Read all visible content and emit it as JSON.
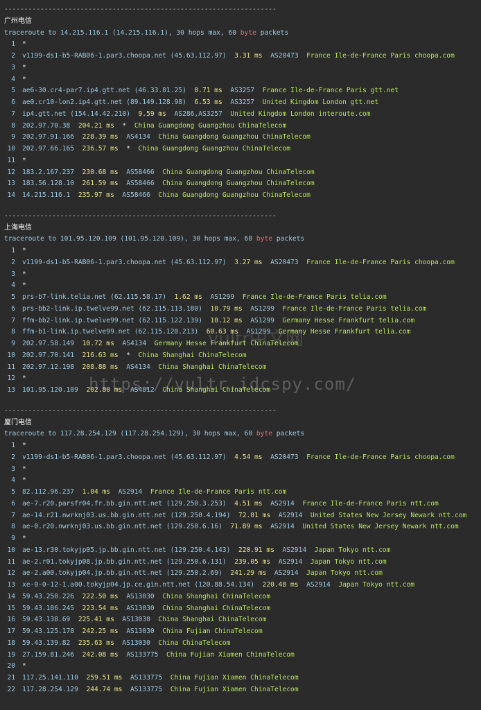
{
  "separator": "--------------------------------------------------------------------",
  "watermark": "https://vultr.idcspy.com/",
  "watermark_cn": "vultr中文网",
  "colors": {
    "background": "#2b2b2b",
    "host": "#9ccde8",
    "latency": "#ede489",
    "geo": "#b5e853",
    "byte": "#e06c75"
  },
  "traces": [
    {
      "title": "广州电信",
      "cmd_pre": "traceroute to 14.215.116.1 (14.215.116.1), 30 hops max, 60 ",
      "cmd_byte": "byte",
      "cmd_post": " packets",
      "hops": [
        {
          "n": "1",
          "star": "*"
        },
        {
          "n": "2",
          "host": "v1199-ds1-b5-RAB06-1.par3.choopa.net (45.63.112.97)",
          "lat": "3.31 ms",
          "asn": "AS20473",
          "geo": "France Ile-de-France Paris choopa.com"
        },
        {
          "n": "3",
          "star": "*"
        },
        {
          "n": "4",
          "star": "*"
        },
        {
          "n": "5",
          "host": "ae6-30.cr4-par7.ip4.gtt.net (46.33.81.25)",
          "lat": "0.71 ms",
          "asn": "AS3257",
          "geo": "France Ile-de-France Paris gtt.net"
        },
        {
          "n": "6",
          "host": "ae0.cr10-lon2.ip4.gtt.net (89.149.128.98)",
          "lat": "6.53 ms",
          "asn": "AS3257",
          "geo": "United Kingdom London gtt.net"
        },
        {
          "n": "7",
          "host": "ip4.gtt.net (154.14.42.210)",
          "lat": "9.59 ms",
          "asn": "AS286,AS3257",
          "geo": "United Kingdom London interoute.com"
        },
        {
          "n": "8",
          "host": "202.97.70.38",
          "lat": "204.21 ms",
          "asn": "*",
          "geo": "China Guangdong Guangzhou ChinaTelecom"
        },
        {
          "n": "9",
          "host": "202.97.91.166",
          "lat": "228.39 ms",
          "asn": "AS4134",
          "geo": "China Guangdong Guangzhou ChinaTelecom"
        },
        {
          "n": "10",
          "host": "202.97.66.165",
          "lat": "236.57 ms",
          "asn": "*",
          "geo": "China Guangdong Guangzhou ChinaTelecom"
        },
        {
          "n": "11",
          "star": "*"
        },
        {
          "n": "12",
          "host": "183.2.167.237",
          "lat": "230.68 ms",
          "asn": "AS58466",
          "geo": "China Guangdong Guangzhou ChinaTelecom"
        },
        {
          "n": "13",
          "host": "183.56.128.10",
          "lat": "261.59 ms",
          "asn": "AS58466",
          "geo": "China Guangdong Guangzhou ChinaTelecom"
        },
        {
          "n": "14",
          "host": "14.215.116.1",
          "lat": "235.97 ms",
          "asn": "AS58466",
          "geo": "China Guangdong Guangzhou ChinaTelecom"
        }
      ]
    },
    {
      "title": "上海电信",
      "cmd_pre": "traceroute to 101.95.120.109 (101.95.120.109), 30 hops max, 60 ",
      "cmd_byte": "byte",
      "cmd_post": " packets",
      "hops": [
        {
          "n": "1",
          "star": "*"
        },
        {
          "n": "2",
          "host": "v1199-ds1-b5-RAB06-1.par3.choopa.net (45.63.112.97)",
          "lat": "3.27 ms",
          "asn": "AS20473",
          "geo": "France Ile-de-France Paris choopa.com"
        },
        {
          "n": "3",
          "star": "*"
        },
        {
          "n": "4",
          "star": "*"
        },
        {
          "n": "5",
          "host": "prs-b7-link.telia.net (62.115.58.17)",
          "lat": "1.62 ms",
          "asn": "AS1299",
          "geo": "France Ile-de-France Paris telia.com"
        },
        {
          "n": "6",
          "host": "prs-bb2-link.ip.twelve99.net (62.115.113.180)",
          "lat": "10.79 ms",
          "asn": "AS1299",
          "geo": "France Ile-de-France Paris telia.com"
        },
        {
          "n": "7",
          "host": "ffm-bb2-link.ip.twelve99.net (62.115.122.139)",
          "lat": "10.12 ms",
          "asn": "AS1299",
          "geo": "Germany Hesse Frankfurt telia.com"
        },
        {
          "n": "8",
          "host": "ffm-b1-link.ip.twelve99.net (62.115.120.213)",
          "lat": "60.63 ms",
          "asn": "AS1299",
          "geo": "Germany Hesse Frankfurt telia.com"
        },
        {
          "n": "9",
          "host": "202.97.58.149",
          "lat": "10.72 ms",
          "asn": "AS4134",
          "geo": "Germany Hesse Frankfurt ChinaTelecom"
        },
        {
          "n": "10",
          "host": "202.97.70.141",
          "lat": "216.63 ms",
          "asn": "*",
          "geo": "China Shanghai ChinaTelecom"
        },
        {
          "n": "11",
          "host": "202.97.12.198",
          "lat": "208.88 ms",
          "asn": "AS4134",
          "geo": "China Shanghai ChinaTelecom"
        },
        {
          "n": "12",
          "star": "*"
        },
        {
          "n": "13",
          "host": "101.95.120.109",
          "lat": "202.80 ms",
          "asn": "AS4812",
          "geo": "China Shanghai ChinaTelecom"
        }
      ]
    },
    {
      "title": "厦门电信",
      "cmd_pre": "traceroute to 117.28.254.129 (117.28.254.129), 30 hops max, 60 ",
      "cmd_byte": "byte",
      "cmd_post": " packets",
      "hops": [
        {
          "n": "1",
          "star": "*"
        },
        {
          "n": "2",
          "host": "v1199-ds1-b5-RAB06-1.par3.choopa.net (45.63.112.97)",
          "lat": "4.54 ms",
          "asn": "AS20473",
          "geo": "France Ile-de-France Paris choopa.com"
        },
        {
          "n": "3",
          "star": "*"
        },
        {
          "n": "4",
          "star": "*"
        },
        {
          "n": "5",
          "host": "82.112.96.237",
          "lat": "1.04 ms",
          "asn": "AS2914",
          "geo": "France Ile-de-France Paris ntt.com"
        },
        {
          "n": "6",
          "host": "ae-7.r20.parsfr04.fr.bb.gin.ntt.net (129.250.3.253)",
          "lat": "4.51 ms",
          "asn": "AS2914",
          "geo": "France Ile-de-France Paris ntt.com"
        },
        {
          "n": "7",
          "host": "ae-14.r21.nwrknj03.us.bb.gin.ntt.net (129.250.4.194)",
          "lat": "72.01 ms",
          "asn": "AS2914",
          "geo": "United States New Jersey Newark ntt.com"
        },
        {
          "n": "8",
          "host": "ae-0.r20.nwrknj03.us.bb.gin.ntt.net (129.250.6.16)",
          "lat": "71.89 ms",
          "asn": "AS2914",
          "geo": "United States New Jersey Newark ntt.com"
        },
        {
          "n": "9",
          "star": "*"
        },
        {
          "n": "10",
          "host": "ae-13.r30.tokyjp05.jp.bb.gin.ntt.net (129.250.4.143)",
          "lat": "220.91 ms",
          "asn": "AS2914",
          "geo": "Japan Tokyo ntt.com"
        },
        {
          "n": "11",
          "host": "ae-2.r01.tokyjp08.jp.bb.gin.ntt.net (129.250.6.131)",
          "lat": "239.05 ms",
          "asn": "AS2914",
          "geo": "Japan Tokyo ntt.com"
        },
        {
          "n": "12",
          "host": "ae-2.a00.tokyjp04.jp.bb.gin.ntt.net (129.250.2.69)",
          "lat": "241.29 ms",
          "asn": "AS2914",
          "geo": "Japan Tokyo ntt.com"
        },
        {
          "n": "13",
          "host": "xe-0-0-12-1.a00.tokyjp04.jp.ce.gin.ntt.net (120.88.54.134)",
          "lat": "220.48 ms",
          "asn": "AS2914",
          "geo": "Japan Tokyo ntt.com"
        },
        {
          "n": "14",
          "host": "59.43.250.226",
          "lat": "222.50 ms",
          "asn": "AS13030",
          "geo": "China Shanghai ChinaTelecom"
        },
        {
          "n": "15",
          "host": "59.43.186.245",
          "lat": "223.54 ms",
          "asn": "AS13030",
          "geo": "China Shanghai ChinaTelecom"
        },
        {
          "n": "16",
          "host": "59.43.138.69",
          "lat": "225.41 ms",
          "asn": "AS13030",
          "geo": "China Shanghai ChinaTelecom"
        },
        {
          "n": "17",
          "host": "59.43.125.178",
          "lat": "242.25 ms",
          "asn": "AS13030",
          "geo": "China Fujian ChinaTelecom"
        },
        {
          "n": "18",
          "host": "59.43.139.82",
          "lat": "235.63 ms",
          "asn": "AS13030",
          "geo": "China ChinaTelecom"
        },
        {
          "n": "19",
          "host": "27.159.81.246",
          "lat": "242.08 ms",
          "asn": "AS133775",
          "geo": "China Fujian Xiamen ChinaTelecom"
        },
        {
          "n": "20",
          "star": "*"
        },
        {
          "n": "21",
          "host": "117.25.141.110",
          "lat": "259.51 ms",
          "asn": "AS133775",
          "geo": "China Fujian Xiamen ChinaTelecom"
        },
        {
          "n": "22",
          "host": "117.28.254.129",
          "lat": "244.74 ms",
          "asn": "AS133775",
          "geo": "China Fujian Xiamen ChinaTelecom"
        }
      ]
    }
  ]
}
